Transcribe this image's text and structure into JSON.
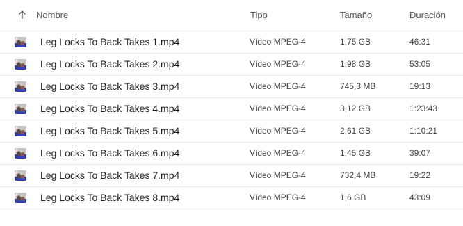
{
  "header": {
    "name": "Nombre",
    "type": "Tipo",
    "size": "Tamaño",
    "duration": "Duración"
  },
  "files": [
    {
      "name": "Leg Locks To Back Takes 1.mp4",
      "type": "Vídeo MPEG-4",
      "size": "1,75 GB",
      "duration": "46:31"
    },
    {
      "name": "Leg Locks To Back Takes 2.mp4",
      "type": "Vídeo MPEG-4",
      "size": "1,98 GB",
      "duration": "53:05"
    },
    {
      "name": "Leg Locks To Back Takes 3.mp4",
      "type": "Vídeo MPEG-4",
      "size": "745,3 MB",
      "duration": "19:13"
    },
    {
      "name": "Leg Locks To Back Takes 4.mp4",
      "type": "Vídeo MPEG-4",
      "size": "3,12 GB",
      "duration": "1:23:43"
    },
    {
      "name": "Leg Locks To Back Takes 5.mp4",
      "type": "Vídeo MPEG-4",
      "size": "2,61 GB",
      "duration": "1:10:21"
    },
    {
      "name": "Leg Locks To Back Takes 6.mp4",
      "type": "Vídeo MPEG-4",
      "size": "1,45 GB",
      "duration": "39:07"
    },
    {
      "name": "Leg Locks To Back Takes 7.mp4",
      "type": "Vídeo MPEG-4",
      "size": "732,4 MB",
      "duration": "19:22"
    },
    {
      "name": "Leg Locks To Back Takes 8.mp4",
      "type": "Vídeo MPEG-4",
      "size": "1,6 GB",
      "duration": "43:09"
    }
  ],
  "icons": {
    "sort": "sort-ascending-arrow-icon",
    "thumbnail": "video-thumbnail-icon"
  },
  "colors": {
    "text": "#1f1f1f",
    "secondary_text": "#444444",
    "header_text": "#555555",
    "divider": "#e6e6e6",
    "thumb_mat": "#2f3fb0",
    "thumb_bg": "#c9c3c0"
  }
}
